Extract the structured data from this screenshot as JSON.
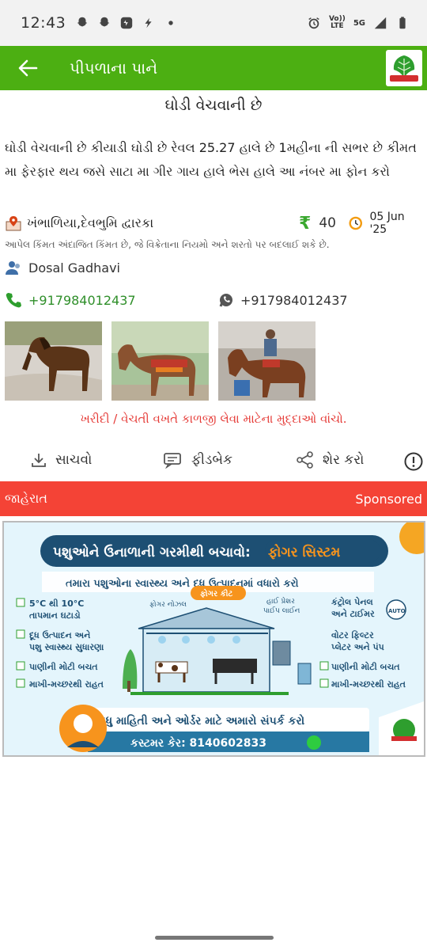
{
  "status_bar": {
    "time": "12:43",
    "network": "5G",
    "volte_line1": "Vo))",
    "volte_line2": "LTE"
  },
  "app_bar": {
    "title": "પીપળાના પાને",
    "logo_text": "પીપળાના પાને"
  },
  "post": {
    "title": "ઘોડી વેચવાની છે",
    "description": "ઘોડી વેચવાની છે કીયાડી ઘોડી છે રેવલ 25.27 હાલે છે 1મહીના ની સભર છે કીમત મા ફેરફાર થય જસે સાટા મા ગીર ગાય હાલે ભેસ હાલે આ નંબર મા ફોન કરો",
    "location": "ખંભાળિયા,દેવભુમિ દ્વારકા",
    "price_symbol": "₹",
    "price": "40",
    "date": "05 Jun '25",
    "disclaimer": "આપેલ કિંમત અંદાજિત કિંમત છે, જે વિક્રેતાના નિયમો અને શરતો પર બદલાઈ શકે છે.",
    "seller": "Dosal Gadhavi",
    "phone": "+917984012437",
    "whatsapp": "+917984012437",
    "warning": "ખરીદી / વેચતી વખતે કાળજી લેવા માટેના મુદ્દાઓ વાંચો."
  },
  "actions": {
    "save": "સાચવો",
    "feedback": "ફીડબેક",
    "share": "શેર કરો"
  },
  "ad": {
    "label": "જાહેરાત",
    "sponsored": "Sponsored",
    "banner": {
      "headline_a": "પશુઓને ઉનાળાની ગરમીથી બચાવો:",
      "headline_b": "ફોગર સિસ્ટમ",
      "subhead": "તમારા પશુઓના સ્વાસ્થ્ય અને દૂધ ઉત્પાદનમાં વધારો કરો",
      "kit_label": "ફોગર કીટ",
      "nozzle": "ફોગર નોઝલ",
      "pipeline_1": "હાઈ પ્રેશર",
      "pipeline_2": "પાઈપ લાઈન",
      "control_1": "કંટ્રોલ પેનલ",
      "control_2": "અને ટાઈમર",
      "filter_1": "વોટર ફિલ્ટર",
      "filter_2": "પ્લેટર અને પંપ",
      "auto": "AUTO",
      "left_1a": "5°C થી 10°C",
      "left_1b": "તાપમાન ઘટાડો",
      "left_2a": "દૂધ ઉત્પાદન અને",
      "left_2b": "પશુ સ્વાસ્થ્ય સુધારણા",
      "left_3": "પાણીની મોટી બચત",
      "left_4": "માખી-મચ્છરથી રાહત",
      "right_3": "પાણીની મોટી બચત",
      "right_4": "માખી-મચ્છરથી રાહત",
      "contact": "વધુ માહિતી અને ઓર્ડર માટે અમારો સંપર્ક કરો",
      "care": "કસ્ટમર કેર: 8140602833"
    }
  },
  "colors": {
    "app_bar": "#4caf12",
    "ad_bar": "#f44336",
    "phone_green": "#2f8f2a",
    "warning_red": "#e53935"
  }
}
